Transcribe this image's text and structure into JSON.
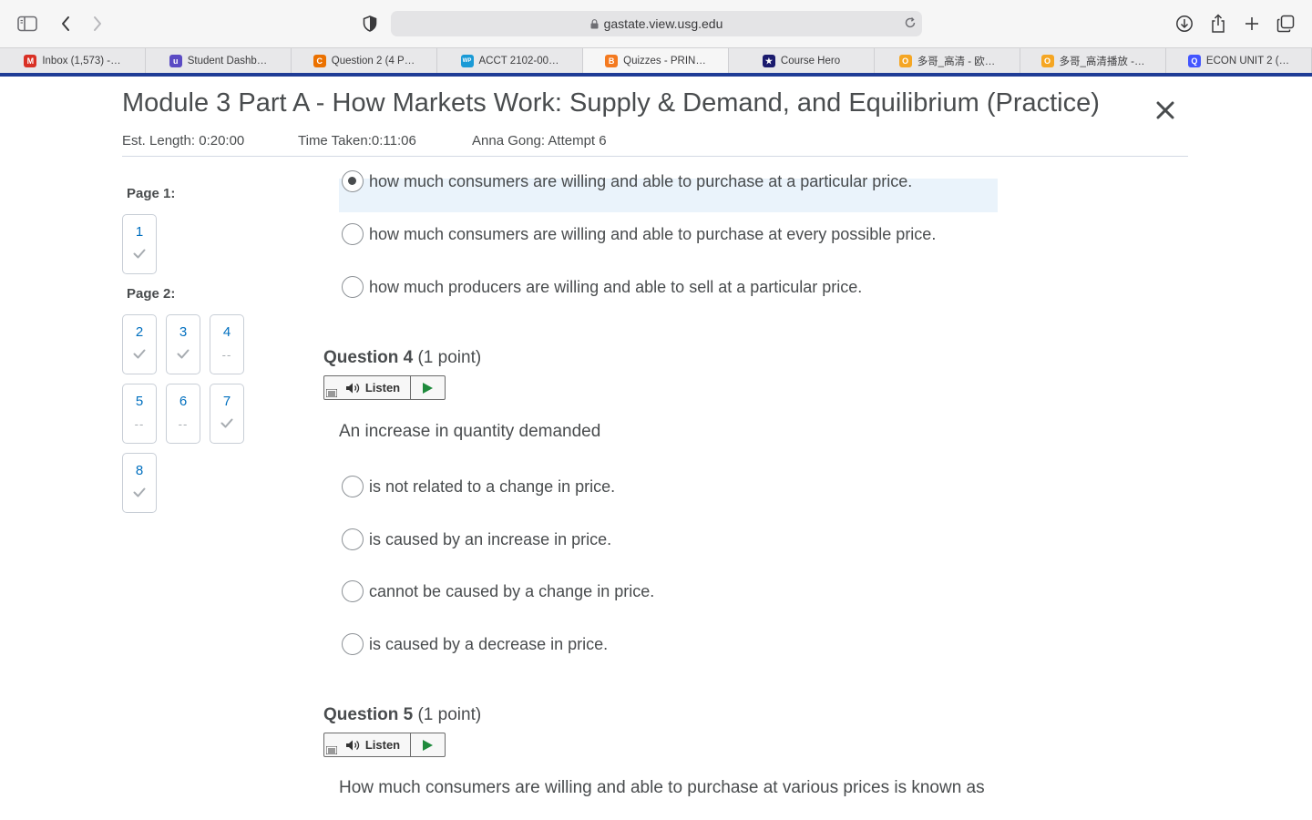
{
  "browser": {
    "url": "gastate.view.usg.edu",
    "tabs": [
      {
        "label": "Inbox (1,573) -…",
        "icon": "gmail-icon",
        "color": "#d93025",
        "glyph": "M"
      },
      {
        "label": "Student Dashb…",
        "icon": "student-dashboard-icon",
        "color": "#5b4bc4",
        "glyph": "u"
      },
      {
        "label": "Question 2 (4 P…",
        "icon": "chegg-icon",
        "color": "#eb7100",
        "glyph": "C"
      },
      {
        "label": "ACCT 2102-00…",
        "icon": "wiley-plus-icon",
        "color": "#1a9ad6",
        "glyph": "WP"
      },
      {
        "label": "Quizzes - PRIN…",
        "icon": "d2l-icon",
        "color": "#f47a20",
        "glyph": "B"
      },
      {
        "label": "Course Hero",
        "icon": "course-hero-icon",
        "color": "#1b1b6e",
        "glyph": "★"
      },
      {
        "label": "多哥_高清 - 欧…",
        "icon": "video-site-icon",
        "color": "#f5a623",
        "glyph": "O"
      },
      {
        "label": "多哥_高清播放 -…",
        "icon": "video-site-icon",
        "color": "#f5a623",
        "glyph": "O"
      },
      {
        "label": "ECON UNIT 2 (…",
        "icon": "quizlet-icon",
        "color": "#4255ff",
        "glyph": "Q"
      }
    ],
    "active_tab": 4
  },
  "quiz": {
    "title": "Module 3 Part A - How Markets Work: Supply & Demand, and Equilibrium (Practice)",
    "est_length": "Est. Length: 0:20:00",
    "time_taken": "Time Taken:0:11:06",
    "attempt": "Anna Gong: Attempt 6"
  },
  "nav": {
    "page1_label": "Page 1:",
    "page2_label": "Page 2:",
    "questions": [
      {
        "num": "1",
        "status": "answered"
      },
      {
        "num": "2",
        "status": "answered"
      },
      {
        "num": "3",
        "status": "answered"
      },
      {
        "num": "4",
        "status": "--"
      },
      {
        "num": "5",
        "status": "--"
      },
      {
        "num": "6",
        "status": "--"
      },
      {
        "num": "7",
        "status": "answered"
      },
      {
        "num": "8",
        "status": "answered"
      }
    ]
  },
  "q3_options": [
    {
      "text": "how much consumers are willing and able to purchase at a particular price.",
      "selected": true
    },
    {
      "text": "how much consumers are willing and able to purchase at every possible price.",
      "selected": false
    },
    {
      "text": "how much producers are willing and able to sell at a particular price.",
      "selected": false
    }
  ],
  "q4": {
    "label": "Question 4",
    "points": "(1 point)",
    "listen": "Listen",
    "text": "An increase in quantity demanded",
    "options": [
      "is not related to a change in price.",
      "is caused by an increase in price.",
      "cannot be caused by a change in price.",
      "is caused by a decrease in price."
    ]
  },
  "q5": {
    "label": "Question 5",
    "points": "(1 point)",
    "listen": "Listen",
    "text": "How much consumers are willing and able to purchase at various prices is known as"
  }
}
